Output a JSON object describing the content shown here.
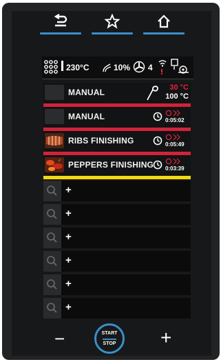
{
  "nav": {
    "back_icon": "back-arrow-icon",
    "favorite_icon": "star-icon",
    "home_icon": "home-icon",
    "accent": "#3a8fc9"
  },
  "status": {
    "temperature": "230°C",
    "humidity": "10%",
    "fan_level": "4"
  },
  "programs": [
    {
      "name": "MANUAL",
      "probe_set": "30 °C",
      "probe_actual": "100 °C",
      "stripe": "#d0233a",
      "thumb": "blank"
    },
    {
      "name": "MANUAL",
      "time": "0:05:02",
      "stripe": "#d0233a",
      "thumb": "blank"
    },
    {
      "name": "RIBS FINISHING",
      "time": "0:05:49",
      "stripe": "#d0233a",
      "thumb": "ribs"
    },
    {
      "name": "PEPPERS FINISHING",
      "time": "0:03:39",
      "stripe": "#f1d90f",
      "thumb": "peppers"
    }
  ],
  "empty_slots": [
    "+",
    "+",
    "+",
    "+",
    "+",
    "+"
  ],
  "bottom": {
    "minus_label": "−",
    "start_label": "START",
    "stop_label": "STOP",
    "plus_label": "+"
  }
}
